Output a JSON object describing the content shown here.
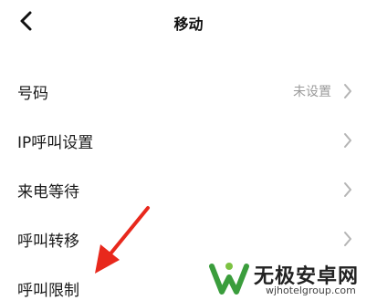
{
  "header": {
    "title": "移动",
    "back_icon": "chevron-left-icon"
  },
  "rows": [
    {
      "label": "号码",
      "value": "未设置"
    },
    {
      "label": "IP呼叫设置",
      "value": ""
    },
    {
      "label": "来电等待",
      "value": ""
    },
    {
      "label": "呼叫转移",
      "value": ""
    },
    {
      "label": "呼叫限制",
      "value": ""
    }
  ],
  "annotation": {
    "icon": "red-arrow-icon",
    "color": "#e8281c"
  },
  "watermark": {
    "name": "无极安卓网",
    "url": "wjhotelgroup.com",
    "logo_colors": [
      "#3a9d3c",
      "#7cc242"
    ]
  }
}
